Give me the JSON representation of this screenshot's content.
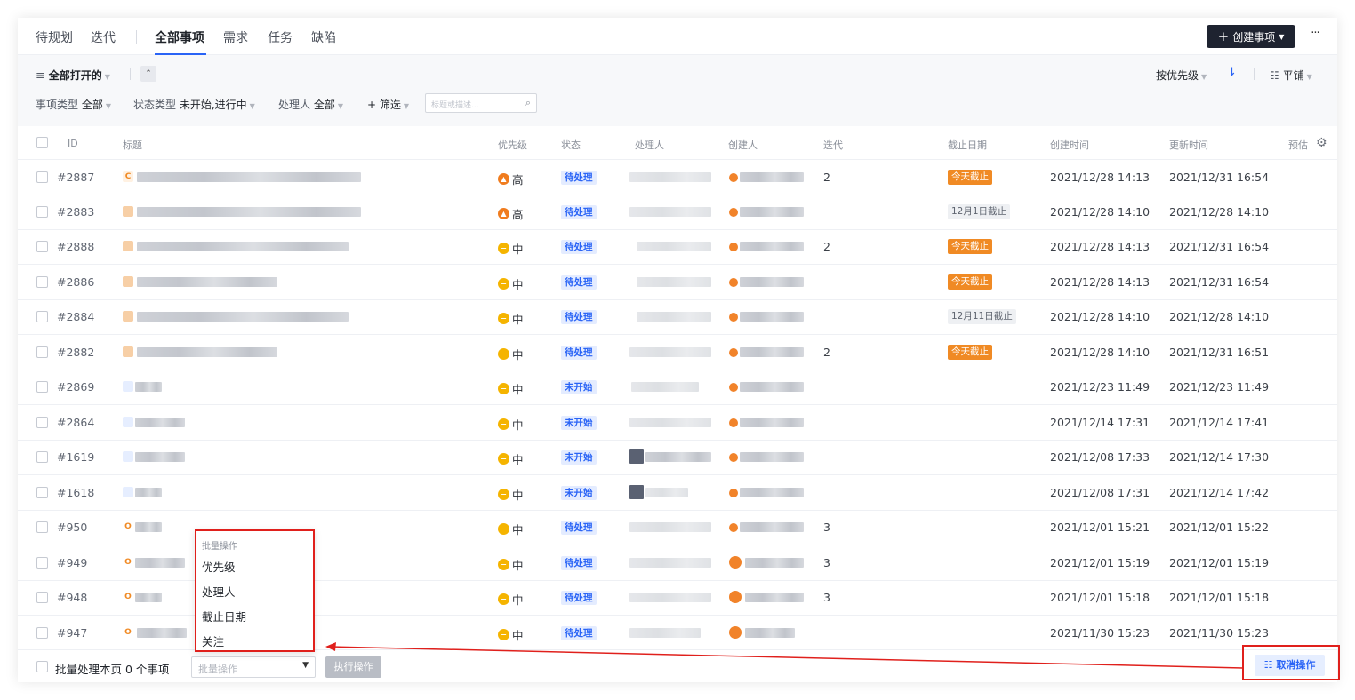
{
  "tabs": [
    {
      "label": "待规划"
    },
    {
      "label": "迭代"
    },
    {
      "label": "全部事项",
      "active": true
    },
    {
      "label": "需求"
    },
    {
      "label": "任务"
    },
    {
      "label": "缺陷"
    }
  ],
  "header": {
    "create_label": "创建事项",
    "more_label": "···"
  },
  "filters": {
    "view_label": "全部打开的",
    "sort_label": "按优先级",
    "layout_label": "平铺",
    "item_type_label": "事项类型",
    "item_type_value": "全部",
    "status_type_label": "状态类型",
    "status_type_value": "未开始,进行中",
    "assignee_label": "处理人",
    "assignee_value": "全部",
    "filter_label": "+ 筛选",
    "search_placeholder": "标题或描述..."
  },
  "columns": {
    "id": "ID",
    "title": "标题",
    "priority": "优先级",
    "status": "状态",
    "assignee": "处理人",
    "creator": "创建人",
    "iteration": "迭代",
    "due": "截止日期",
    "created": "创建时间",
    "updated": "更新时间",
    "estimate": "预估"
  },
  "rows": [
    {
      "id": "#2887",
      "icon": "C",
      "priority": "高",
      "status": "待处理",
      "iteration": "2",
      "due": "今天截止",
      "created": "2021/12/28 14:13",
      "updated": "2021/12/31 16:54"
    },
    {
      "id": "#2883",
      "icon": "",
      "priority": "高",
      "status": "待处理",
      "iteration": "",
      "due": "12月1日截止",
      "created": "2021/12/28 14:10",
      "updated": "2021/12/28 14:10"
    },
    {
      "id": "#2888",
      "icon": "",
      "priority": "中",
      "status": "待处理",
      "iteration": "2",
      "due": "今天截止",
      "created": "2021/12/28 14:13",
      "updated": "2021/12/31 16:54"
    },
    {
      "id": "#2886",
      "icon": "",
      "priority": "中",
      "status": "待处理",
      "iteration": "",
      "due": "今天截止",
      "created": "2021/12/28 14:13",
      "updated": "2021/12/31 16:54"
    },
    {
      "id": "#2884",
      "icon": "",
      "priority": "中",
      "status": "待处理",
      "iteration": "",
      "due": "12月11日截止",
      "created": "2021/12/28 14:10",
      "updated": "2021/12/28 14:10"
    },
    {
      "id": "#2882",
      "icon": "",
      "priority": "中",
      "status": "待处理",
      "iteration": "2",
      "due": "今天截止",
      "created": "2021/12/28 14:10",
      "updated": "2021/12/31 16:51"
    },
    {
      "id": "#2869",
      "icon": "",
      "priority": "中",
      "status": "未开始",
      "iteration": "",
      "due": "",
      "created": "2021/12/23 11:49",
      "updated": "2021/12/23 11:49"
    },
    {
      "id": "#2864",
      "icon": "",
      "priority": "中",
      "status": "未开始",
      "iteration": "",
      "due": "",
      "created": "2021/12/14 17:31",
      "updated": "2021/12/14 17:41"
    },
    {
      "id": "#1619",
      "icon": "",
      "priority": "中",
      "status": "未开始",
      "iteration": "",
      "due": "",
      "created": "2021/12/08 17:33",
      "updated": "2021/12/14 17:30"
    },
    {
      "id": "#1618",
      "icon": "",
      "priority": "中",
      "status": "未开始",
      "iteration": "",
      "due": "",
      "created": "2021/12/08 17:31",
      "updated": "2021/12/14 17:42"
    },
    {
      "id": "#950",
      "icon": "O",
      "priority": "中",
      "status": "待处理",
      "iteration": "3",
      "due": "",
      "created": "2021/12/01 15:21",
      "updated": "2021/12/01 15:22"
    },
    {
      "id": "#949",
      "icon": "O",
      "priority": "中",
      "status": "待处理",
      "iteration": "3",
      "due": "",
      "created": "2021/12/01 15:19",
      "updated": "2021/12/01 15:19"
    },
    {
      "id": "#948",
      "icon": "O",
      "priority": "中",
      "status": "待处理",
      "iteration": "3",
      "due": "",
      "created": "2021/12/01 15:18",
      "updated": "2021/12/01 15:18"
    },
    {
      "id": "#947",
      "icon": "O",
      "priority": "中",
      "status": "待处理",
      "iteration": "",
      "due": "",
      "created": "2021/11/30 15:23",
      "updated": "2021/11/30 15:23"
    }
  ],
  "batch_menu": {
    "title": "批量操作",
    "items": [
      "优先级",
      "处理人",
      "截止日期",
      "关注"
    ]
  },
  "footer": {
    "batch_text": "批量处理本页 0 个事项",
    "select_placeholder": "批量操作",
    "exec_label": "执行操作",
    "cancel_label": "取消操作"
  },
  "colors": {
    "accent": "#2a64f6",
    "highlight": "#e0201c",
    "due_today": "#f08a24",
    "priority_high": "#f07c1e",
    "priority_mid": "#f5b400"
  }
}
